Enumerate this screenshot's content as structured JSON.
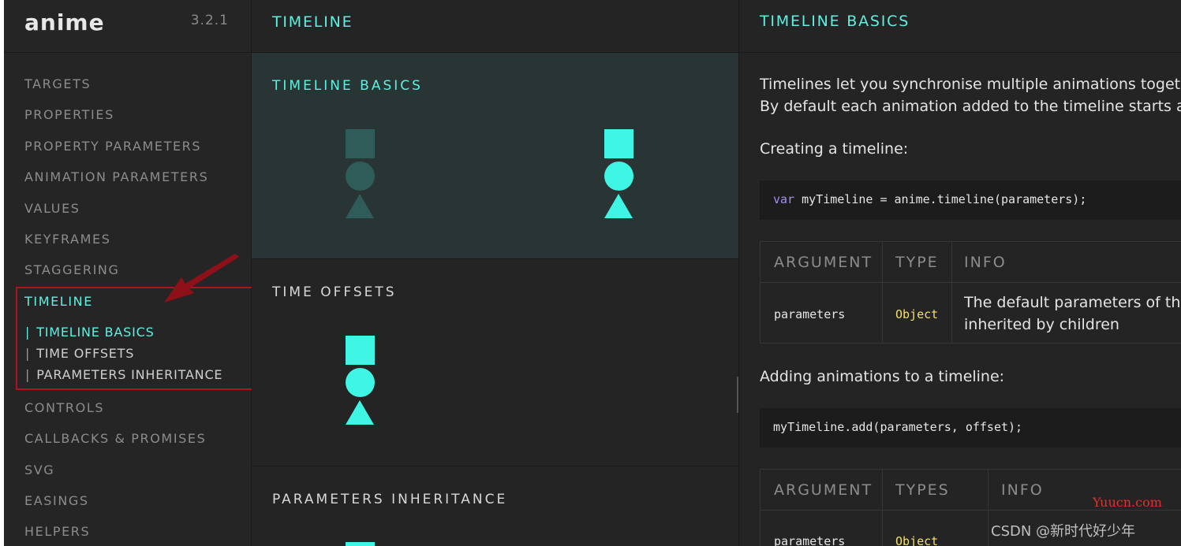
{
  "app": {
    "logo": "anime",
    "version": "3.2.1"
  },
  "sidebar": {
    "items": [
      {
        "label": "TARGETS"
      },
      {
        "label": "PROPERTIES"
      },
      {
        "label": "PROPERTY PARAMETERS"
      },
      {
        "label": "ANIMATION PARAMETERS"
      },
      {
        "label": "VALUES"
      },
      {
        "label": "KEYFRAMES"
      },
      {
        "label": "STAGGERING"
      },
      {
        "label": "TIMELINE"
      },
      {
        "label": "CONTROLS"
      },
      {
        "label": "CALLBACKS & PROMISES"
      },
      {
        "label": "SVG"
      },
      {
        "label": "EASINGS"
      },
      {
        "label": "HELPERS"
      }
    ],
    "active_item": "TIMELINE",
    "subitems": [
      {
        "label": "TIMELINE BASICS"
      },
      {
        "label": "TIME OFFSETS"
      },
      {
        "label": "PARAMETERS INHERITANCE"
      }
    ],
    "active_subitem": "TIMELINE BASICS"
  },
  "middle": {
    "title": "TIMELINE",
    "demos": [
      {
        "title": "TIMELINE BASICS"
      },
      {
        "title": "TIME OFFSETS"
      },
      {
        "title": "PARAMETERS INHERITANCE"
      }
    ]
  },
  "docs": {
    "title": "TIMELINE BASICS",
    "intro_line1": "Timelines let you synchronise multiple animations togeth",
    "intro_line2": "By default each animation added to the timeline starts af",
    "creating_label": "Creating a timeline:",
    "code1_kw": "var",
    "code1_rest": " myTimeline = anime.timeline(parameters);",
    "table1": {
      "headers": [
        "ARGUMENT",
        "TYPE",
        "INFO"
      ],
      "row": {
        "argument": "parameters",
        "type": "Object",
        "info_line1": "The default parameters of th",
        "info_line2": "inherited by children"
      }
    },
    "adding_label": "Adding animations to a timeline:",
    "code2": "myTimeline.add(parameters, offset);",
    "table2": {
      "headers": [
        "ARGUMENT",
        "TYPES",
        "INFO"
      ],
      "row": {
        "argument": "parameters",
        "type": "Object"
      }
    }
  },
  "watermarks": {
    "yuucn": "Yuucn.com",
    "csdn": "CSDN @新时代好少年"
  },
  "colors": {
    "accent": "#5ef0e0",
    "shape_bright": "#3ef6e3",
    "shape_dim": "#2f5c58",
    "annotation": "#b0111c",
    "type_yellow": "#f3e065",
    "keyword_purple": "#a88df3"
  }
}
